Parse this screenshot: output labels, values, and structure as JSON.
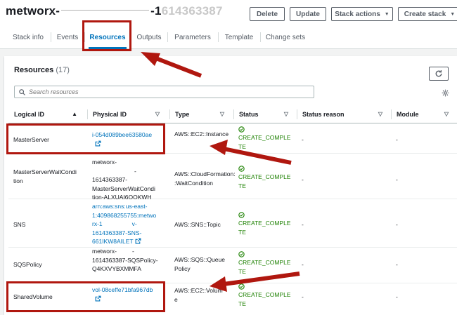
{
  "header": {
    "stack_prefix": "metworx-",
    "stack_suffix": "-1",
    "stack_blur": "614363387",
    "buttons": {
      "delete": "Delete",
      "update": "Update",
      "stack_actions": "Stack actions",
      "create_stack": "Create stack"
    }
  },
  "tabs": [
    {
      "label": "Stack info"
    },
    {
      "label": "Events"
    },
    {
      "label": "Resources"
    },
    {
      "label": "Outputs"
    },
    {
      "label": "Parameters"
    },
    {
      "label": "Template"
    },
    {
      "label": "Change sets"
    }
  ],
  "resources": {
    "title": "Resources",
    "count": "(17)",
    "search_placeholder": "Search resources",
    "columns": {
      "logical_id": "Logical ID",
      "physical_id": "Physical ID",
      "type": "Type",
      "status": "Status",
      "status_reason": "Status reason",
      "module": "Module"
    },
    "rows": [
      {
        "logical_id": "MasterServer",
        "physical_id": "i-054d089bee63580ae",
        "type": "AWS::EC2::Instance",
        "status_1": "CREATE_COMPLE",
        "status_2": "TE",
        "reason": "-",
        "module": "-"
      },
      {
        "logical_id_1": "MasterServerWaitCondi",
        "logical_id_2": "tion",
        "physical_id_1": "metworx-",
        "physical_id_2": "1614363387-",
        "physical_id_3": "MasterServerWaitCondi",
        "physical_id_4": "tion-ALXUAI6OOKWH",
        "type_1": "AWS::CloudFormation:",
        "type_2": ":WaitCondition",
        "status_1": "CREATE_COMPLE",
        "status_2": "TE",
        "reason": "-",
        "module": "-"
      },
      {
        "logical_id": "SNS",
        "physical_id_1": "arn:aws:sns:us-east-",
        "physical_id_2": "1:409868255755:metwo",
        "physical_id_3": "rx-1",
        "physical_id_3b": "v-",
        "physical_id_4": "1614363387-SNS-",
        "physical_id_5": "661IKW8AILET",
        "type": "AWS::SNS::Topic",
        "status_1": "CREATE_COMPLE",
        "status_2": "TE",
        "reason": "-",
        "module": "-"
      },
      {
        "logical_id": "SQSPolicy",
        "physical_id_1": "metworx-",
        "physical_id_2": "1614363387-SQSPolicy-",
        "physical_id_3": "Q4KXVYBXMMFA",
        "type_1": "AWS::SQS::Queue",
        "type_2": "Policy",
        "status_1": "CREATE_COMPLE",
        "status_2": "TE",
        "reason": "-",
        "module": "-"
      },
      {
        "logical_id": "SharedVolume",
        "physical_id": "vol-08ceffe71bfa967db",
        "type_1": "AWS::EC2::Volum",
        "type_2": "e",
        "status_1": "CREATE_COMPLE",
        "status_2": "TE",
        "reason": "-",
        "module": "-"
      }
    ]
  },
  "colors": {
    "accent": "#0073bb",
    "success": "#1d8102",
    "annotation": "#b0170f"
  }
}
